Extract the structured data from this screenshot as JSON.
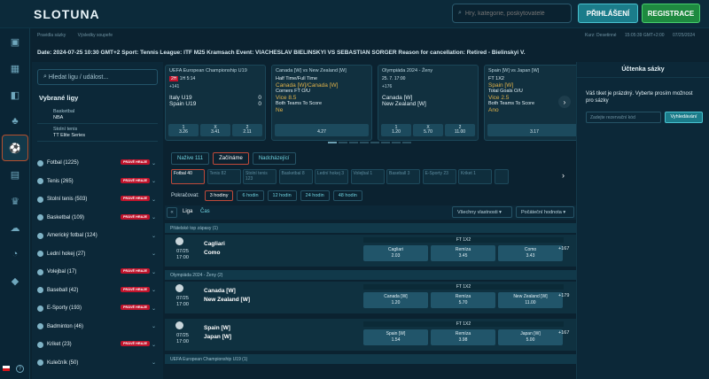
{
  "header": {
    "logo": "SLOTUNA",
    "search_placeholder": "Hry, kategorie, poskytovatelé",
    "login": "PŘIHLÁŠENÍ",
    "register": "REGISTRACE"
  },
  "breadcrumbs": [
    "Pravidla sázky",
    "Výsledky soupeře"
  ],
  "topright": [
    "Kurz: Desetinné",
    "15:05:39 GMT+2:00",
    "07/25/2024"
  ],
  "notice": "Date: 2024-07-25 10:30 GMT+2 Sport: Tennis League: ITF M25 Kramsach Event: VIACHESLAV BIELINSKYI VS SEBASTIAN SORGER Reason for cancellation: Retired - Bielinskyi V.",
  "sidebar": {
    "search": "Hledat ligu / událost...",
    "fav_title": "Vybrané ligy",
    "favs": [
      {
        "sport": "Basketbal",
        "league": "NBA"
      },
      {
        "sport": "Stolní tenis",
        "league": "TT Elite Series"
      }
    ],
    "badge": "PRÁVĚ HRAJE",
    "sports": [
      {
        "name": "Fotbal (1225)",
        "live": true
      },
      {
        "name": "Tenis (265)",
        "live": true
      },
      {
        "name": "Stolní tenis (503)",
        "live": true
      },
      {
        "name": "Basketbal (109)",
        "live": true
      },
      {
        "name": "Americký fotbal (124)",
        "live": false
      },
      {
        "name": "Lední hokej (27)",
        "live": false
      },
      {
        "name": "Volejbal (17)",
        "live": true
      },
      {
        "name": "Baseball (42)",
        "live": true
      },
      {
        "name": "E-Sporty (193)",
        "live": true
      },
      {
        "name": "Badminton (46)",
        "live": false
      },
      {
        "name": "Kriket (23)",
        "live": true
      },
      {
        "name": "Kulečník (50)",
        "live": false
      }
    ]
  },
  "cards": [
    {
      "league": "UEFA European Championship U19",
      "status": "2H",
      "time": "1H 5:14",
      "count": "+141",
      "t1": "Italy U19",
      "t2": "Spain U19",
      "s1": "0",
      "s2": "0",
      "odds": [
        [
          "1",
          "3.26"
        ],
        [
          "X",
          "3.41"
        ],
        [
          "2",
          "2.11"
        ]
      ]
    },
    {
      "league": "Canada [W] vs New Zealand [W]",
      "lines": [
        "Half Time/Full Time",
        "Canada [W]/Canada [W]",
        "Corners FT O/U",
        "Vice 8.5",
        "Both Teams To Score",
        "Ne"
      ],
      "odds": [
        [
          "",
          "4.27"
        ]
      ]
    },
    {
      "league": "Olympiáda 2024 - Ženy",
      "time": "25. 7. 17:00",
      "count": "+176",
      "t1": "Canada [W]",
      "t2": "New Zealand [W]",
      "odds": [
        [
          "1",
          "1.20"
        ],
        [
          "X",
          "5.70"
        ],
        [
          "2",
          "11.00"
        ]
      ]
    },
    {
      "league": "Spain [W] vs Japan [W]",
      "lines": [
        "FT 1X2",
        "Spain [W]",
        "Total Goals O/U",
        "Vice 2.5",
        "Both Teams To Score",
        "Ano"
      ],
      "odds": [
        [
          "",
          "3.17"
        ]
      ]
    }
  ],
  "tabs": [
    "Nažive 111",
    "Začínáme",
    "Nadcházející"
  ],
  "sport_chips": [
    "Fotbal 40",
    "Tenis 82",
    "Stolní tenis 123",
    "Basketbal 8",
    "Lední hokej 3",
    "Volejbal 1",
    "Baseball 3",
    "E-Sporty 23",
    "Kriket 1",
    ""
  ],
  "time_label": "Pokračovat:",
  "time_filters": [
    "3 hodiny",
    "6 hodin",
    "12 hodin",
    "24 hodin",
    "48 hodin"
  ],
  "filters": {
    "league": "Liga",
    "time": "Čas",
    "all_props": "Všechny vlastnosti",
    "sort": "Počáteční hodnota"
  },
  "leagues": [
    "Přátelské top zápasy (1)",
    "Olympiáda 2024 - Ženy (2)",
    "UEFA European Championship U19 (1)"
  ],
  "events": [
    {
      "date": "07/25",
      "time": "17:00",
      "t1": "Cagliari",
      "t2": "Como",
      "market": "FT 1X2",
      "o": [
        [
          "Cagliari",
          "2.03"
        ],
        [
          "Remíza",
          "3.45"
        ],
        [
          "Como",
          "3.43"
        ]
      ],
      "more": "+167"
    },
    {
      "date": "07/25",
      "time": "17:00",
      "t1": "Canada [W]",
      "t2": "New Zealand [W]",
      "market": "FT 1X2",
      "o": [
        [
          "Canada [W]",
          "1.20"
        ],
        [
          "Remíza",
          "5.70"
        ],
        [
          "New Zealand [W]",
          "11.00"
        ]
      ],
      "more": "+179"
    },
    {
      "date": "07/25",
      "time": "17:00",
      "t1": "Spain [W]",
      "t2": "Japan [W]",
      "market": "FT 1X2",
      "o": [
        [
          "Spain [W]",
          "1.54"
        ],
        [
          "Remíza",
          "3.98"
        ],
        [
          "Japan [W]",
          "5.00"
        ]
      ],
      "more": "+167"
    }
  ],
  "betslip": {
    "title": "Účtenka sázky",
    "text": "Váš tiket je prázdný. Vyberte prosím možnost pro sázky",
    "input": "Zadejte rezervační kód",
    "button": "Vyhledávání"
  }
}
